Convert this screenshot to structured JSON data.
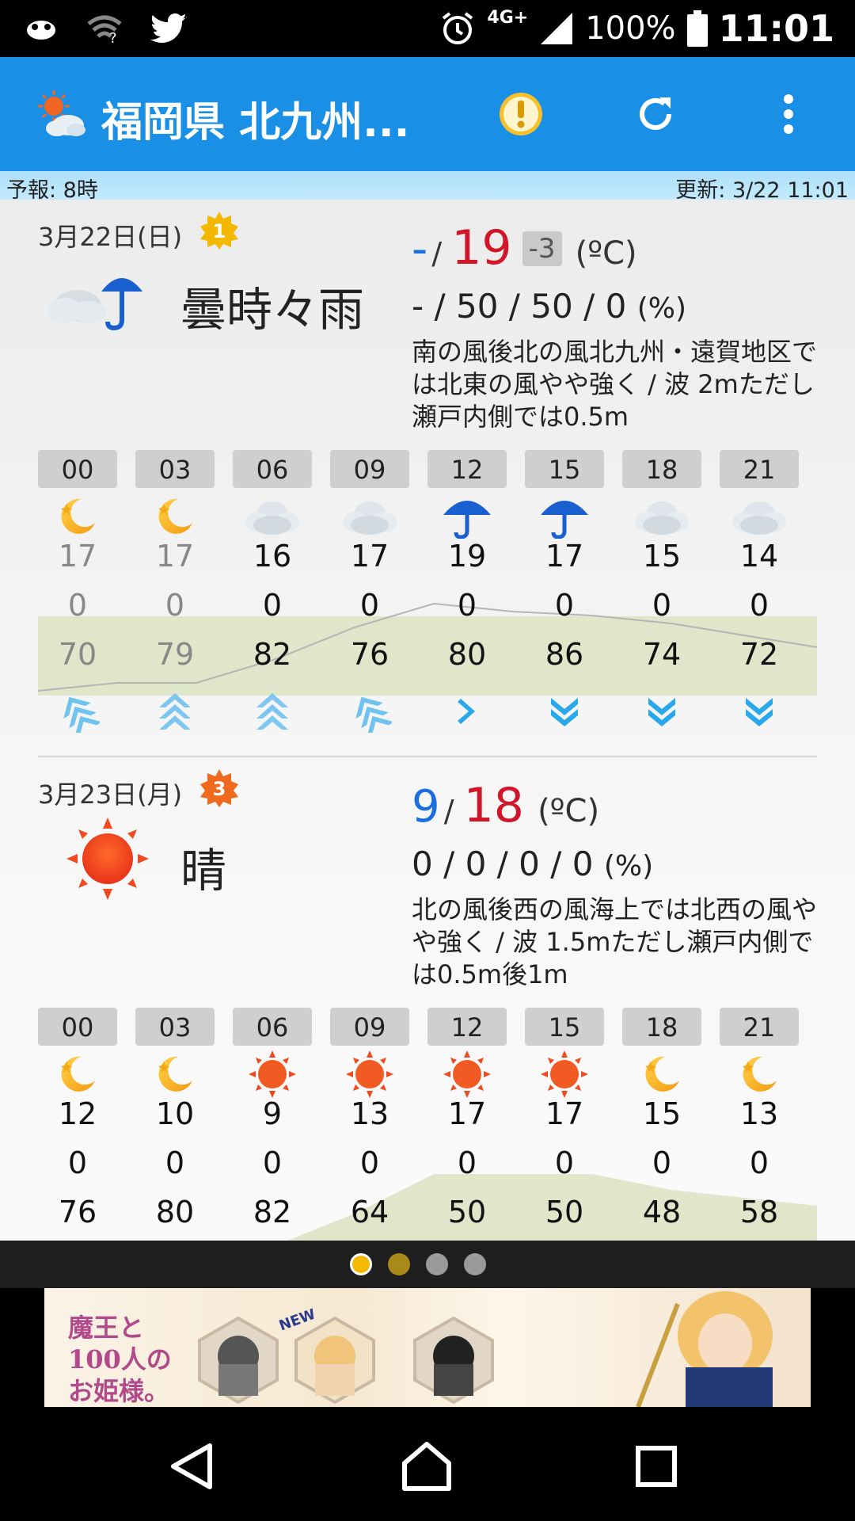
{
  "status_bar": {
    "network": "4G+",
    "battery": "100%",
    "time": "11:01"
  },
  "app_bar": {
    "title": "福岡県 北九州..."
  },
  "sub_header": {
    "forecast_time": "予報: 8時",
    "updated": "更新: 3/22 11:01"
  },
  "days": [
    {
      "date": "3月22日(日)",
      "rank": "1",
      "weather": "曇時々雨",
      "temp_min": "-",
      "temp_max": "19",
      "temp_diff": "-3",
      "temp_unit": "(ºC)",
      "pop": "- / 50 / 50 / 0",
      "pop_unit": "(%)",
      "wind": "南の風後北の風北九州・遠賀地区では北東の風やや強く / 波 2mただし瀬戸内側では0.5m",
      "hours": [
        {
          "time": "00",
          "icon": "moon-icon",
          "temp": "17",
          "rain": "0",
          "humidity": "70",
          "wind_dir": "sw",
          "past": true
        },
        {
          "time": "03",
          "icon": "moon-icon",
          "temp": "17",
          "rain": "0",
          "humidity": "79",
          "wind_dir": "s",
          "past": true
        },
        {
          "time": "06",
          "icon": "cloud-icon",
          "temp": "16",
          "rain": "0",
          "humidity": "82",
          "wind_dir": "s",
          "past": false
        },
        {
          "time": "09",
          "icon": "cloud-icon",
          "temp": "17",
          "rain": "0",
          "humidity": "76",
          "wind_dir": "sw",
          "past": false
        },
        {
          "time": "12",
          "icon": "umbrella-icon",
          "temp": "19",
          "rain": "0",
          "humidity": "80",
          "wind_dir": "w",
          "past": false
        },
        {
          "time": "15",
          "icon": "umbrella-icon",
          "temp": "17",
          "rain": "0",
          "humidity": "86",
          "wind_dir": "n",
          "past": false
        },
        {
          "time": "18",
          "icon": "cloud-icon",
          "temp": "15",
          "rain": "0",
          "humidity": "74",
          "wind_dir": "n",
          "past": false
        },
        {
          "time": "21",
          "icon": "cloud-icon",
          "temp": "14",
          "rain": "0",
          "humidity": "72",
          "wind_dir": "n",
          "past": false
        }
      ]
    },
    {
      "date": "3月23日(月)",
      "rank": "3",
      "weather": "晴",
      "temp_min": "9",
      "temp_max": "18",
      "temp_unit": "(ºC)",
      "pop": "0 / 0 / 0 / 0",
      "pop_unit": "(%)",
      "wind": "北の風後西の風海上では北西の風やや強く / 波 1.5mただし瀬戸内側では0.5m後1m",
      "hours": [
        {
          "time": "00",
          "icon": "moon-icon",
          "temp": "12",
          "rain": "0",
          "humidity": "76"
        },
        {
          "time": "03",
          "icon": "moon-icon",
          "temp": "10",
          "rain": "0",
          "humidity": "80"
        },
        {
          "time": "06",
          "icon": "sun-icon",
          "temp": "9",
          "rain": "0",
          "humidity": "82"
        },
        {
          "time": "09",
          "icon": "sun-icon",
          "temp": "13",
          "rain": "0",
          "humidity": "64"
        },
        {
          "time": "12",
          "icon": "sun-icon",
          "temp": "17",
          "rain": "0",
          "humidity": "50"
        },
        {
          "time": "15",
          "icon": "sun-icon",
          "temp": "17",
          "rain": "0",
          "humidity": "50"
        },
        {
          "time": "18",
          "icon": "moon-icon",
          "temp": "15",
          "rain": "0",
          "humidity": "48"
        },
        {
          "time": "21",
          "icon": "moon-icon",
          "temp": "13",
          "rain": "0",
          "humidity": "58"
        }
      ]
    }
  ],
  "pager": {
    "pages": 4,
    "active": 0
  },
  "ad": {
    "title": "魔王と100人のお姫様。",
    "badge": "NEW"
  },
  "colors": {
    "app_bar": "#1a8fe6",
    "temp_max": "#d2162a",
    "temp_min": "#1a6fe0",
    "humidity_band": "#dfe6c9"
  }
}
